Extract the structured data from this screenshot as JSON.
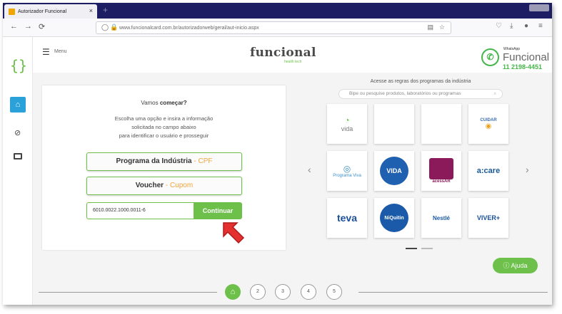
{
  "browser": {
    "tab_title": "Autorizador Funcional",
    "tab_close": "×",
    "new_tab": "+",
    "back": "←",
    "forward": "→",
    "reload": "⟳",
    "url": "www.funcionalcard.com.br/autorizadorweb/geral/aut-inicio.aspx"
  },
  "header": {
    "menu_label": "Menu",
    "logo": "funcional",
    "logo_sub": "health tech",
    "whatsapp_label": "WhatsApp",
    "whatsapp_brand": "Funcional",
    "whatsapp_phone": "11 2198-4451"
  },
  "card": {
    "title_prefix": "Vamos ",
    "title_bold": "começar?",
    "desc_line1": "Escolha uma opção e insira a informação",
    "desc_line2": "solicitada no campo abaixo",
    "desc_line3": "para identificar o usuário e prosseguir",
    "option1_label": "Programa da Indústria",
    "option1_accent": "CPF",
    "option2_label": "Voucher",
    "option2_accent": "Cupom",
    "separator": " - ",
    "input_value": "6010.0022.1000.0011-6",
    "continue_label": "Continuar"
  },
  "programs": {
    "title": "Acesse as regras dos programas da indústria",
    "search_placeholder": "Bipe ou pesquise produtos, laboratórios ou programas",
    "tiles": [
      {
        "label": "vida",
        "color": "#7a7a7a"
      },
      {
        "label": "",
        "color": "#999"
      },
      {
        "label": "",
        "color": "#999"
      },
      {
        "label": "CUIDAR",
        "color": "#3a6fb0"
      },
      {
        "label": "Programa Viva",
        "color": "#3a8fc8"
      },
      {
        "label": "VIDA",
        "color": "#ffffff"
      },
      {
        "label": "acessAR",
        "color": "#8a1a5a"
      },
      {
        "label": "a:care",
        "color": "#1a5a9a"
      },
      {
        "label": "teva",
        "color": "#1a4f9a"
      },
      {
        "label": "NiQuitin",
        "color": "#ffffff"
      },
      {
        "label": "Nestlé",
        "color": "#1a5aa8"
      },
      {
        "label": "VIVER+",
        "color": "#1a4f9a"
      }
    ]
  },
  "stepper": {
    "home_icon": "⌂",
    "steps": [
      "2",
      "3",
      "4",
      "5"
    ]
  },
  "help_label": "Ajuda",
  "colors": {
    "brand_green": "#6dc04a",
    "accent_orange": "#f4a339",
    "sidebar_blue": "#2aa1d8",
    "tabbar": "#1d1d63"
  }
}
